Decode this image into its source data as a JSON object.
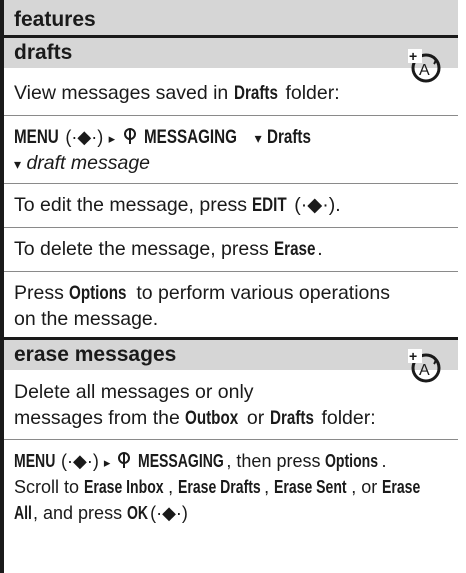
{
  "header": {
    "title": "features"
  },
  "drafts": {
    "title": "drafts",
    "intro_prefix": "View messages saved in ",
    "intro_folder": "Drafts",
    "intro_suffix": " folder:",
    "path_menu": "MENU",
    "path_nav": "(·◆·)",
    "path_arrow": "▸",
    "path_messaging": "MESSAGING",
    "path_drop": "▾",
    "path_drafts": "Drafts",
    "path_item": "draft message",
    "edit_prefix": "To edit the message, press ",
    "edit_key": "EDIT",
    "edit_suffix": " (·◆·).",
    "delete_prefix": "To delete the message, press ",
    "delete_key": "Erase",
    "delete_suffix": ".",
    "options_prefix": "Press ",
    "options_key": "Options",
    "options_suffix": " to perform various operations",
    "options_line2": "on the message."
  },
  "erase": {
    "title": "erase messages",
    "line1": "Delete all messages or only",
    "line2_prefix": "messages from the ",
    "line2_outbox": "Outbox",
    "line2_mid": " or ",
    "line2_drafts": "Drafts",
    "line2_suffix": " folder:",
    "inst_menu": "MENU",
    "inst_nav": "(·◆·)",
    "inst_arrow": "▸",
    "inst_messaging": "MESSAGING",
    "inst_then": ", then press ",
    "inst_options": "Options",
    "inst_period": ".",
    "scroll_prefix": "Scroll to ",
    "opt1": "Erase Inbox",
    "opt2": "Erase Drafts",
    "opt3": "Erase Sent",
    "or": ", or ",
    "opt4a": "Erase",
    "opt4b": "All",
    "and_press": ", and press ",
    "ok_key": "OK",
    "ok_nav": "(·◆·)"
  }
}
